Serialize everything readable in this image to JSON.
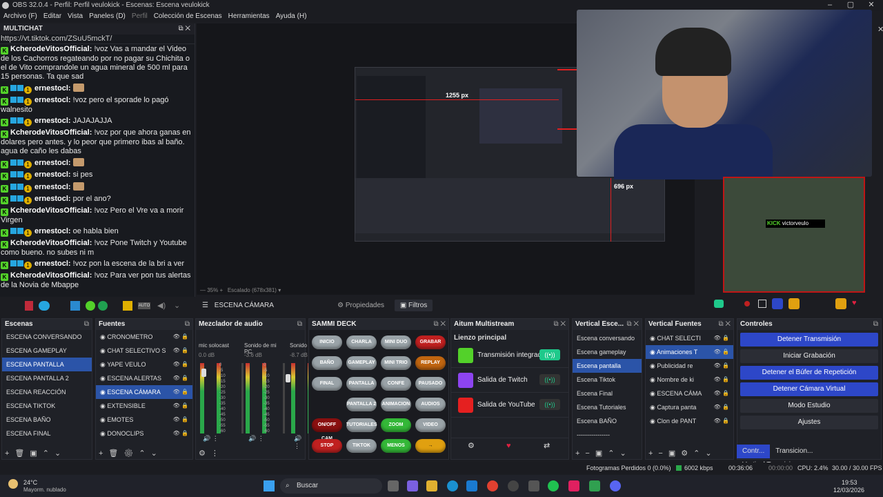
{
  "window": {
    "title": "OBS 32.0.4 - Perfil: Perfil veulokick - Escenas: Escena veulokick"
  },
  "menu": [
    "Archivo (F)",
    "Editar",
    "Vista",
    "Paneles (D)",
    "Perfil",
    "Colección de Escenas",
    "Herramientas",
    "Ayuda (H)"
  ],
  "chat": {
    "title": "MULTICHAT",
    "link": "https://vt.tiktok.com/ZSuU5mckT/",
    "messages": [
      {
        "user": "KcherodeVitosOfficial:",
        "text": "!voz Vas a mandar el Video de los Cachorros regateando por no pagar su Chichita o el de Vito comprandole un agua mineral de 500 ml para 15 personas. Ta que sad",
        "badges": false
      },
      {
        "user": "ernestocl:",
        "text": "",
        "badges": true,
        "emote": true
      },
      {
        "user": "ernestocl:",
        "text": "!voz pero el sporade lo pagó walnesito",
        "badges": true
      },
      {
        "user": "ernestocl:",
        "text": "JAJAJAJJA",
        "badges": true
      },
      {
        "user": "KcherodeVitosOfficial:",
        "text": "!voz por que ahora ganas en dolares pero antes. y lo peor que primero ibas al baño. agua de caño les dabas",
        "badges": false
      },
      {
        "user": "ernestocl:",
        "text": "",
        "badges": true,
        "emote": true
      },
      {
        "user": "ernestocl:",
        "text": "si pes",
        "badges": true
      },
      {
        "user": "ernestocl:",
        "text": "",
        "badges": true,
        "emote": true
      },
      {
        "user": "ernestocl:",
        "text": "por el ano?",
        "badges": true
      },
      {
        "user": "KcherodeVitosOfficial:",
        "text": "!voz Pero el Vre va a morir Virgen",
        "badges": false
      },
      {
        "user": "ernestocl:",
        "text": "oe habla bien",
        "badges": true
      },
      {
        "user": "KcherodeVitosOfficial:",
        "text": "!voz Pone Twitch y Youtube como bueno. no subes ni m",
        "badges": false
      },
      {
        "user": "ernestocl:",
        "text": "!voz pon la escena de la bri a ver",
        "badges": true
      },
      {
        "user": "KcherodeVitosOfficial:",
        "text": "!voz Para ver pon tus alertas de la Novia de Mbappe",
        "badges": false
      }
    ]
  },
  "preview": {
    "measure1": "1255 px",
    "measure2": "696 px",
    "zoom": "35%",
    "scale": "Escalado (678x381)",
    "kick_user": "victorveulo"
  },
  "scenebar": {
    "current": "ESCENA CÁMARA",
    "properties": "Propiedades",
    "filters": "Filtros"
  },
  "scenes": {
    "title": "Escenas",
    "items": [
      "ESCENA CONVERSANDO",
      "ESCENA GAMEPLAY",
      "ESCENA PANTALLA",
      "ESCENA PANTALLA 2",
      "ESCENA REACCIÓN",
      "ESCENA TIKTOK",
      "ESCENA BAÑO",
      "ESCENA FINAL"
    ],
    "selected": 2
  },
  "sources": {
    "title": "Fuentes",
    "items": [
      "CRONOMETRO",
      "CHAT SELECTIVO S",
      "YAPE VEULO",
      "ESCENA ALERTAS",
      "ESCENA CÁMARA",
      "EXTENSIBLE",
      "EMOTES",
      "DONOCLIPS"
    ],
    "selected": 4
  },
  "mixer": {
    "title": "Mezclador de audio",
    "channels": [
      {
        "name": "mic solocast",
        "db": "0.0 dB"
      },
      {
        "name": "Sonido de mi PC",
        "db": "-3.6 dB"
      },
      {
        "name": "Sonido de",
        "db": "-8.7 dB"
      }
    ],
    "scale": [
      "0",
      "-5",
      "-10",
      "-15",
      "-20",
      "-25",
      "-30",
      "-35",
      "-40",
      "-45",
      "-50",
      "-55",
      "-60"
    ]
  },
  "sammi": {
    "title": "SAMMI DECK",
    "buttons": [
      {
        "label": "INICIO",
        "c": "g"
      },
      {
        "label": "CHARLA",
        "c": "g"
      },
      {
        "label": "MINI DUO",
        "c": "g"
      },
      {
        "label": "GRABAR",
        "c": "r"
      },
      {
        "label": "BAÑO",
        "c": "g"
      },
      {
        "label": "GAMEPLAY",
        "c": "g"
      },
      {
        "label": "MINI TRIO",
        "c": "g"
      },
      {
        "label": "REPLAY",
        "c": "o"
      },
      {
        "label": "FINAL",
        "c": "g"
      },
      {
        "label": "PANTALLA",
        "c": "g"
      },
      {
        "label": "CONFE",
        "c": "g"
      },
      {
        "label": "PAUSADO",
        "c": "g"
      },
      {
        "label": "",
        "c": ""
      },
      {
        "label": "PANTALLA 2",
        "c": "g"
      },
      {
        "label": "ANIMACION",
        "c": "g"
      },
      {
        "label": "AUDIOS",
        "c": "g"
      },
      {
        "label": "ON/OFF CAM",
        "c": "dr"
      },
      {
        "label": "TUTORIALES",
        "c": "g"
      },
      {
        "label": "ZOOM",
        "c": "gr"
      },
      {
        "label": "VIDEO",
        "c": "g"
      },
      {
        "label": "STOP",
        "c": "r"
      },
      {
        "label": "TIKTOK",
        "c": "g"
      },
      {
        "label": "MENOS",
        "c": "gr"
      },
      {
        "label": "→",
        "c": "y"
      }
    ]
  },
  "multistream": {
    "title": "Aitum Multistream",
    "heading": "Lienzo principal",
    "outputs": [
      {
        "name": "Transmisión integrada",
        "on": true,
        "color": "#53d12a"
      },
      {
        "name": "Salida de Twitch",
        "on": false,
        "color": "#8d44f0"
      },
      {
        "name": "Salida de YouTube",
        "on": false,
        "color": "#e52020"
      }
    ]
  },
  "vscenes": {
    "title": "Vertical Esce...",
    "items": [
      "Escena conversando",
      "Escena gameplay",
      "Escena pantalla",
      "Escena Tiktok",
      "Escena Final",
      "Escena Tutoriales",
      "Escena BAÑO",
      "----------------"
    ],
    "selected": 2
  },
  "vsources": {
    "title": "Vertical Fuentes",
    "items": [
      "CHAT SELECTI",
      "Animaciones T",
      "Publicidad re",
      "Nombre de ki",
      "ESCENA CÁMA",
      "Captura panta",
      "Clon de PANT"
    ],
    "selected": 1
  },
  "controls": {
    "title": "Controles",
    "buttons": [
      {
        "label": "Detener Transmisión",
        "blue": true
      },
      {
        "label": "Iniciar Grabación",
        "blue": false
      },
      {
        "label": "Detener el Búfer de Repetición",
        "blue": true
      },
      {
        "label": "Detener Cámara Virtual",
        "blue": true
      },
      {
        "label": "Modo Estudio",
        "blue": false
      },
      {
        "label": "Ajustes",
        "blue": false
      }
    ],
    "tabs": [
      "Contr...",
      "Transicion...",
      "Vertical Transicion..."
    ]
  },
  "status": {
    "dropped": "Fotogramas Perdidos 0 (0.0%)",
    "kbps": "6002 kbps",
    "time_live": "00:36:06",
    "time_rec": "00:00:00",
    "cpu": "CPU: 2.4%",
    "fps": "30.00 / 30.00 FPS"
  },
  "taskbar": {
    "temp": "24°C",
    "weather": "Mayorm. nublado",
    "search": "Buscar",
    "time": "19:53",
    "date": "12/03/2026"
  },
  "colors": {
    "accent": "#2d47c8",
    "selected": "#2b54a8",
    "kick": "#53d12a"
  }
}
